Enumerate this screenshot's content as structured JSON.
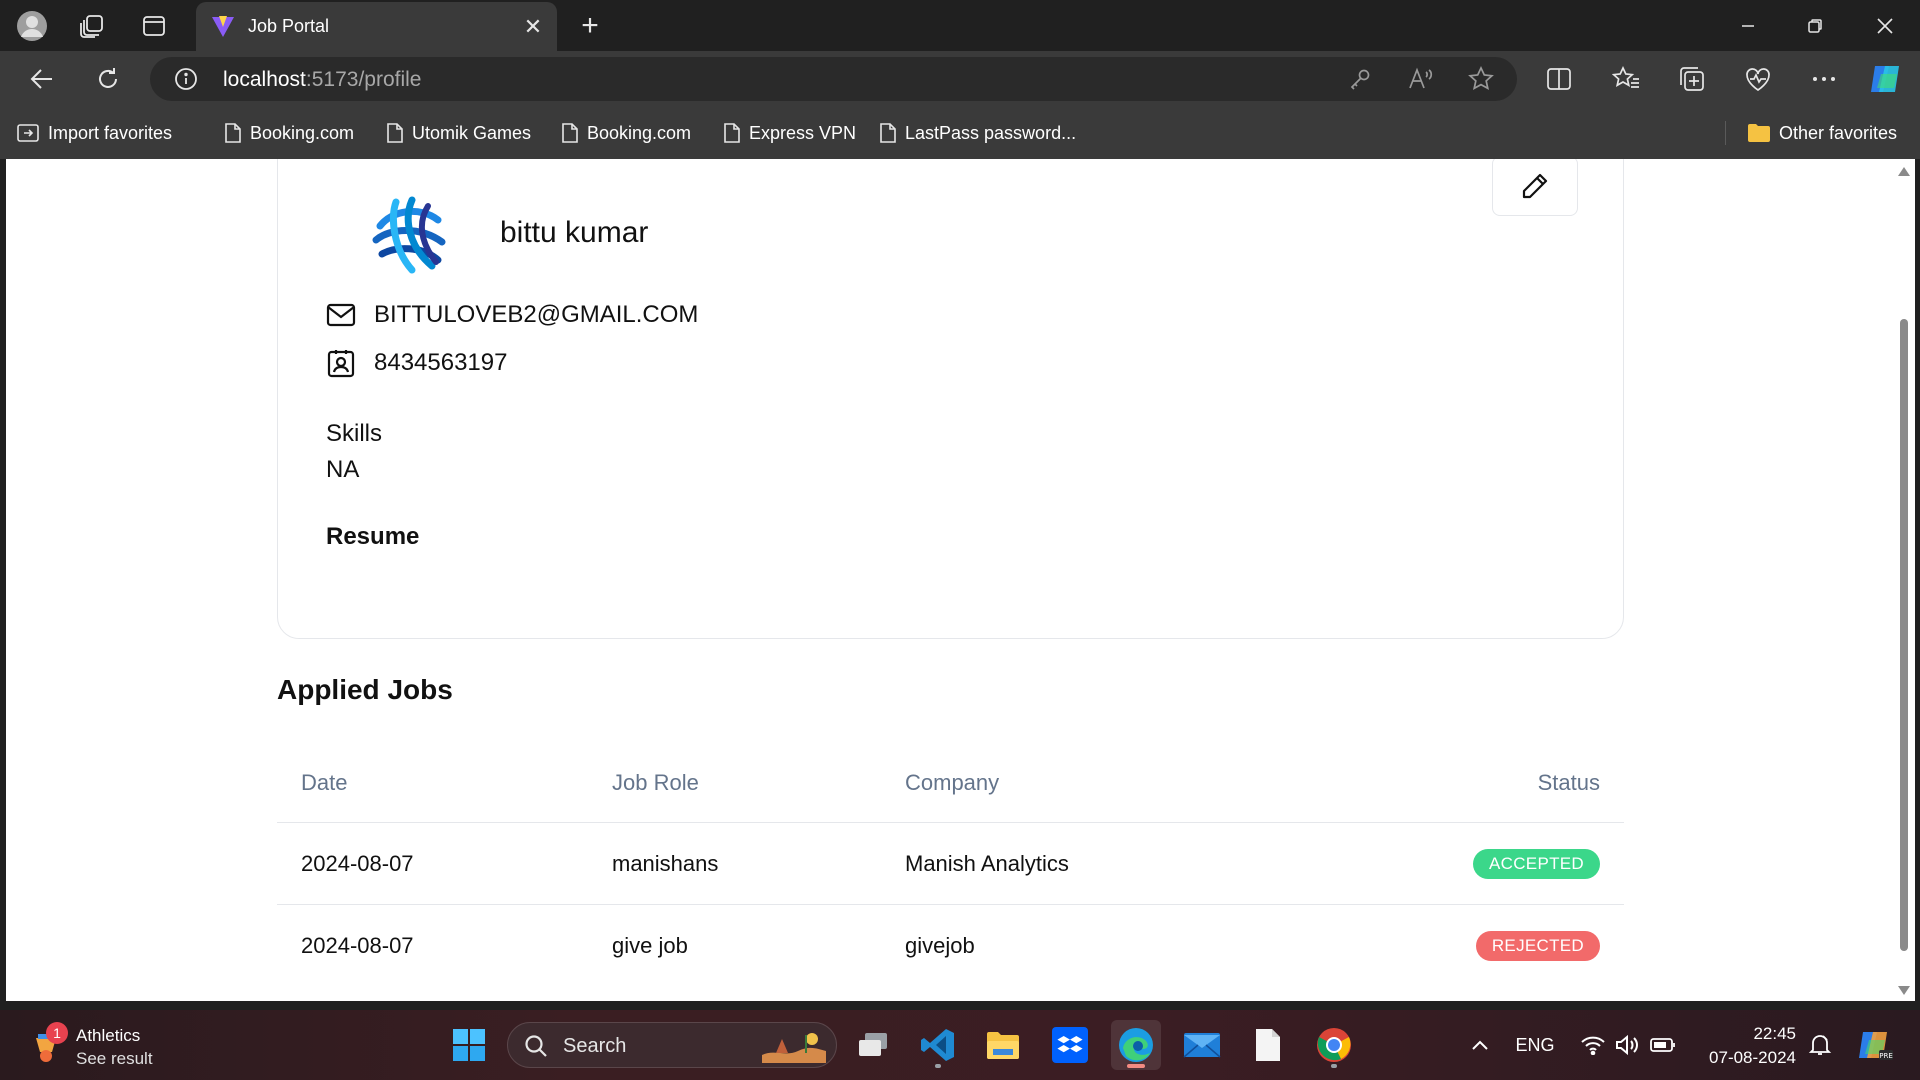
{
  "browser": {
    "tab_title": "Job Portal",
    "url_host": "localhost",
    "url_rest": ":5173/profile",
    "favorites": [
      {
        "label": "Import favorites"
      },
      {
        "label": "Booking.com"
      },
      {
        "label": "Utomik Games"
      },
      {
        "label": "Booking.com"
      },
      {
        "label": "Express VPN"
      },
      {
        "label": "LastPass password..."
      }
    ],
    "other_favorites": "Other favorites"
  },
  "profile": {
    "name": "bittu kumar",
    "email": "BITTULOVEB2@GMAIL.COM",
    "phone": "8434563197",
    "skills_label": "Skills",
    "skills_value": "NA",
    "resume_label": "Resume"
  },
  "applied_jobs": {
    "title": "Applied Jobs",
    "headers": {
      "date": "Date",
      "role": "Job Role",
      "company": "Company",
      "status": "Status"
    },
    "rows": [
      {
        "date": "2024-08-07",
        "role": "manishans",
        "company": "Manish Analytics",
        "status": "ACCEPTED"
      },
      {
        "date": "2024-08-07",
        "role": "give job",
        "company": "givejob",
        "status": "REJECTED"
      }
    ]
  },
  "colors": {
    "accepted": "#3bd78a",
    "rejected": "#f26a6a",
    "header_text": "#64748b"
  },
  "taskbar": {
    "weather_title": "Athletics",
    "weather_sub": "See result",
    "weather_badge": "1",
    "search_label": "Search",
    "lang": "ENG",
    "time": "22:45",
    "date": "07-08-2024"
  }
}
